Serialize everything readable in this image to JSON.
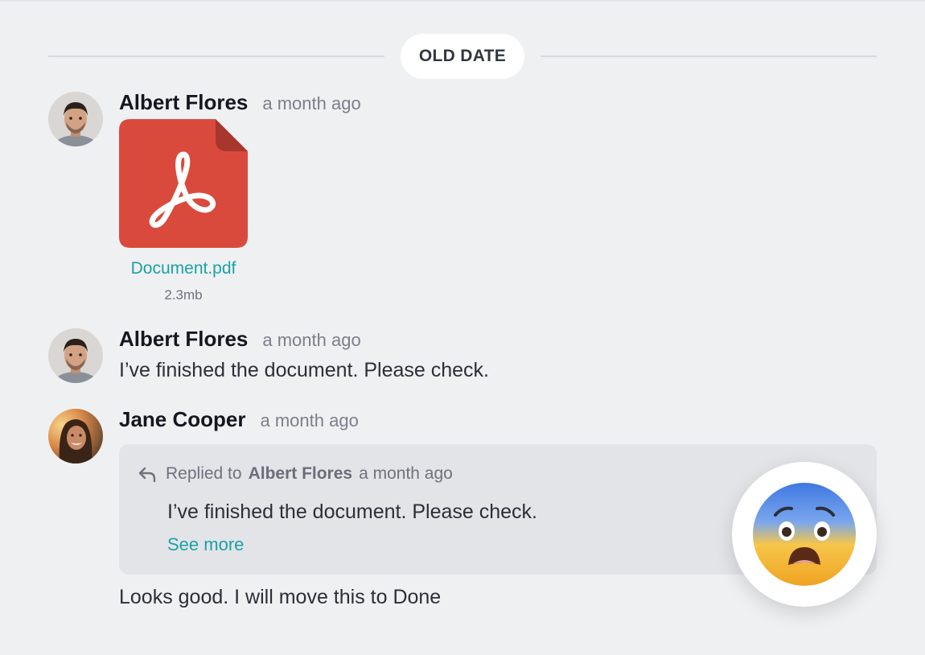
{
  "divider": {
    "label": "OLD DATE"
  },
  "messages": [
    {
      "author": "Albert Flores",
      "time": "a month ago",
      "attachment": {
        "icon": "pdf-file-icon",
        "name": "Document.pdf",
        "size": "2.3mb"
      }
    },
    {
      "author": "Albert Flores",
      "time": "a month ago",
      "text": "I’ve finished the document. Please check."
    },
    {
      "author": "Jane Cooper",
      "time": "a month ago",
      "reply": {
        "prefix": "Replied to",
        "author": "Albert Flores",
        "time": "a month ago",
        "text": "I’ve finished the document. Please check.",
        "see_more": "See more"
      },
      "text": "Looks good. I will move this to Done",
      "reaction": "anxious-face-emoji"
    }
  ],
  "colors": {
    "accent": "#1aa2a6",
    "pdf_red": "#d94a3d",
    "background": "#eff0f2"
  }
}
